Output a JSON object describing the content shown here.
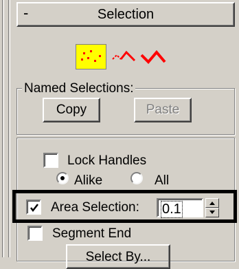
{
  "rollout": {
    "collapse_symbol": "-",
    "title": "Selection"
  },
  "selection_levels": [
    {
      "name": "vertex-level",
      "active": true
    },
    {
      "name": "segment-level",
      "active": false
    },
    {
      "name": "spline-level",
      "active": false
    }
  ],
  "named_selections": {
    "label": "Named Selections:",
    "copy_label": "Copy",
    "paste_label": "Paste",
    "paste_enabled": false
  },
  "lock_handles": {
    "label": "Lock Handles",
    "checked": false,
    "options": [
      {
        "label": "Alike",
        "selected": true
      },
      {
        "label": "All",
        "selected": false
      }
    ]
  },
  "area_selection": {
    "label": "Area Selection:",
    "checked": true,
    "value": "0.1"
  },
  "segment_end": {
    "label": "Segment End",
    "checked": false
  },
  "select_by_label": "Select By...",
  "colors": {
    "panel_bg": "#d4d0c8",
    "active_level_bg": "#ffff00",
    "level_icon": "#ff0000",
    "highlight_border": "#000000"
  }
}
